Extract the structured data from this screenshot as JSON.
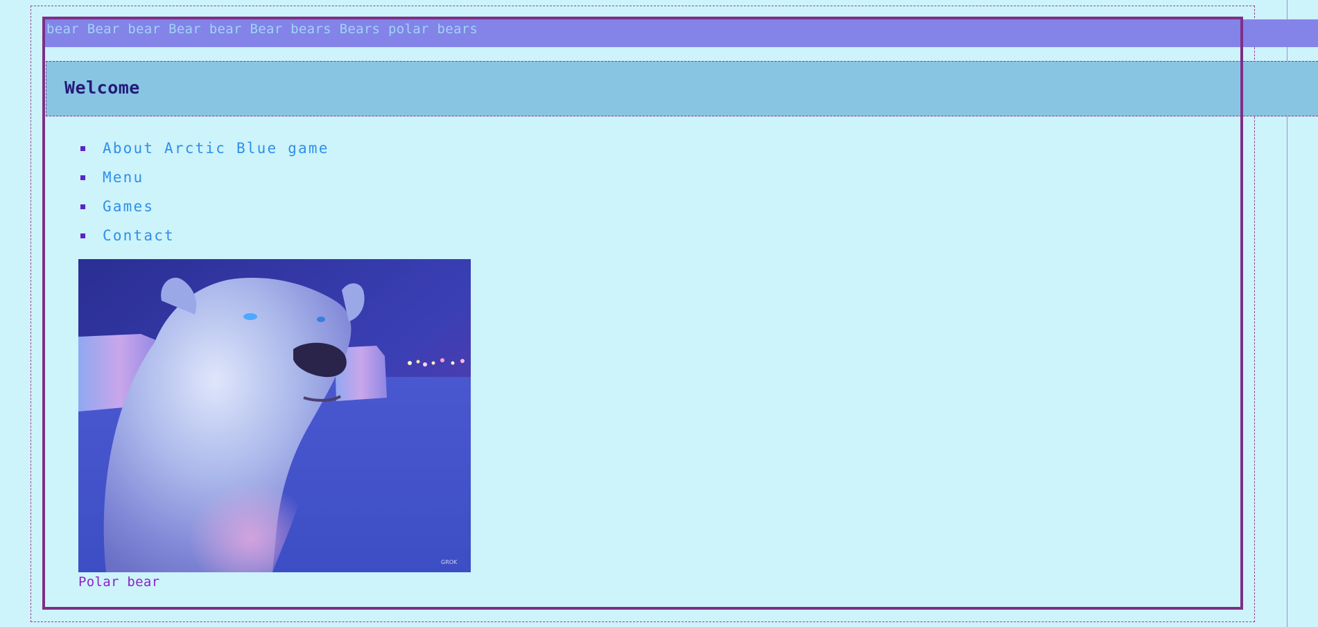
{
  "header": {
    "keywords": "bear Bear bear Bear bear Bear bears Bears polar bears"
  },
  "hero": {
    "title": "Welcome"
  },
  "nav": {
    "items": [
      {
        "label": "About Arctic Blue game"
      },
      {
        "label": "Menu"
      },
      {
        "label": "Games"
      },
      {
        "label": "Contact"
      }
    ]
  },
  "figure": {
    "caption": "Polar bear",
    "alt": "Polar bear",
    "watermark": "GROK"
  },
  "colors": {
    "page_background": "#cdf3fb",
    "keyword_bar": "#8383e8",
    "welcome_bar": "#88c5e3",
    "frame": "#7e2f86",
    "link": "#2f8fe8",
    "caption": "#8b24c9"
  }
}
